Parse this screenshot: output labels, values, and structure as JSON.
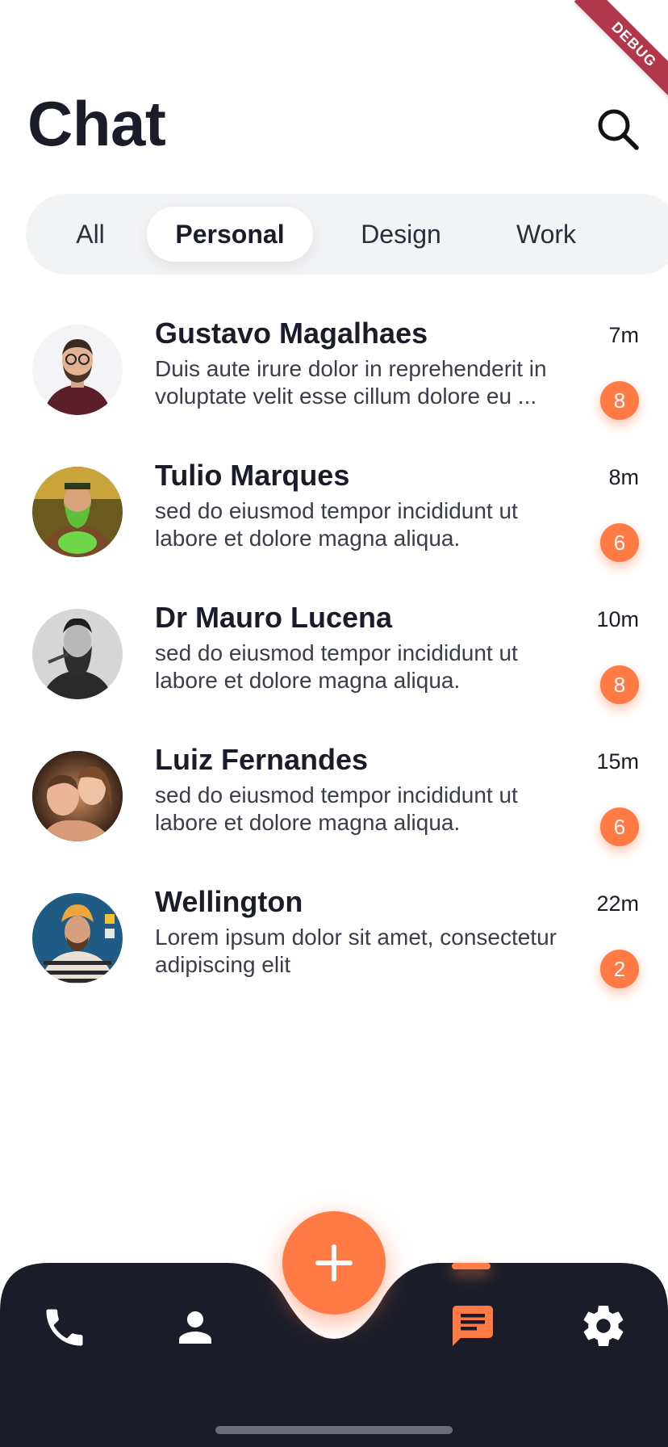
{
  "debug": {
    "label": "DEBUG"
  },
  "header": {
    "title": "Chat"
  },
  "tabs": [
    {
      "label": "All",
      "active": false
    },
    {
      "label": "Personal",
      "active": true
    },
    {
      "label": "Design",
      "active": false
    },
    {
      "label": "Work",
      "active": false
    }
  ],
  "chats": [
    {
      "name": "Gustavo Magalhaes",
      "message": "Duis aute irure dolor in reprehenderit in voluptate velit esse cillum dolore eu ...",
      "time": "7m",
      "unread": "8"
    },
    {
      "name": "Tulio Marques",
      "message": "sed do eiusmod tempor incididunt ut labore et dolore magna aliqua.",
      "time": "8m",
      "unread": "6"
    },
    {
      "name": "Dr Mauro Lucena",
      "message": "sed do eiusmod tempor incididunt ut labore et dolore magna aliqua.",
      "time": "10m",
      "unread": "8"
    },
    {
      "name": "Luiz Fernandes",
      "message": "sed do eiusmod tempor incididunt ut labore et dolore magna aliqua.",
      "time": "15m",
      "unread": "6"
    },
    {
      "name": "Wellington",
      "message": "Lorem ipsum dolor sit amet, consectetur adipiscing elit",
      "time": "22m",
      "unread": "2"
    }
  ],
  "nav": {
    "items": [
      "phone-icon",
      "person-icon",
      "chat-icon",
      "gear-icon"
    ],
    "active": "chat-icon",
    "fab_icon": "plus-icon"
  },
  "colors": {
    "accent": "#ff7a45",
    "navBackground": "#1a1d29",
    "text": "#1a1d29"
  }
}
